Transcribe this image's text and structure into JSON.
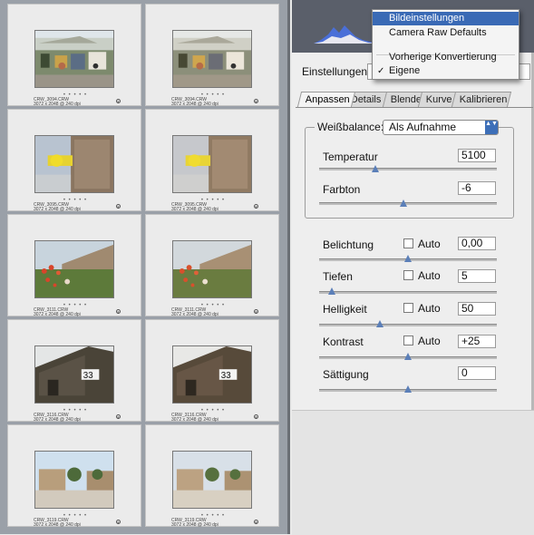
{
  "browser": {
    "rows": [
      {
        "left": {
          "file": "CRW_3094.CRW",
          "meta": "3072 x 2048 @ 240 dpi"
        },
        "right": {
          "file": "CRW_3094.CRW",
          "meta": "3072 x 2048 @ 240 dpi"
        }
      },
      {
        "left": {
          "file": "CRW_3095.CRW",
          "meta": "3072 x 2048 @ 240 dpi"
        },
        "right": {
          "file": "CRW_3095.CRW",
          "meta": "3072 x 2048 @ 240 dpi"
        }
      },
      {
        "left": {
          "file": "CRW_3111.CRW",
          "meta": "3072 x 2048 @ 240 dpi"
        },
        "right": {
          "file": "CRW_3111.CRW",
          "meta": "3072 x 2048 @ 240 dpi"
        }
      },
      {
        "left": {
          "file": "CRW_3116.CRW",
          "meta": "3072 x 2048 @ 240 dpi"
        },
        "right": {
          "file": "CRW_3116.CRW",
          "meta": "3072 x 2048 @ 240 dpi"
        }
      },
      {
        "left": {
          "file": "CRW_3119.CRW",
          "meta": "3072 x 2048 @ 240 dpi"
        },
        "right": {
          "file": "CRW_3119.CRW",
          "meta": "3072 x 2048 @ 240 dpi"
        }
      }
    ],
    "dots": "• • • • •",
    "badge": "®"
  },
  "menu": {
    "items": [
      "Bildeinstellungen",
      "Camera Raw Defaults",
      "Vorherige Konvertierung",
      "Eigene"
    ],
    "checkmark": "✓"
  },
  "settings": {
    "label": "Einstellungen:"
  },
  "tabs": [
    "Anpassen",
    "Details",
    "Blende",
    "Kurve",
    "Kalibrieren"
  ],
  "whitebalance": {
    "label": "Weißbalance:",
    "value": "Als Aufnahme",
    "arrow": "▲▼"
  },
  "controls": {
    "temperatur": {
      "label": "Temperatur",
      "value": "5100"
    },
    "farbton": {
      "label": "Farbton",
      "value": "-6"
    },
    "belichtung": {
      "label": "Belichtung",
      "value": "0,00",
      "auto": "Auto"
    },
    "tiefen": {
      "label": "Tiefen",
      "value": "5",
      "auto": "Auto"
    },
    "helligkeit": {
      "label": "Helligkeit",
      "value": "50",
      "auto": "Auto"
    },
    "kontrast": {
      "label": "Kontrast",
      "value": "+25",
      "auto": "Auto"
    },
    "saettigung": {
      "label": "Sättigung",
      "value": "0"
    }
  },
  "colors": {
    "menu_highlight": "#3a6ab5",
    "slider_knob": "#5b7fb8",
    "panel_bg": "#eeeeee",
    "browser_bg": "#9aa0a8"
  }
}
